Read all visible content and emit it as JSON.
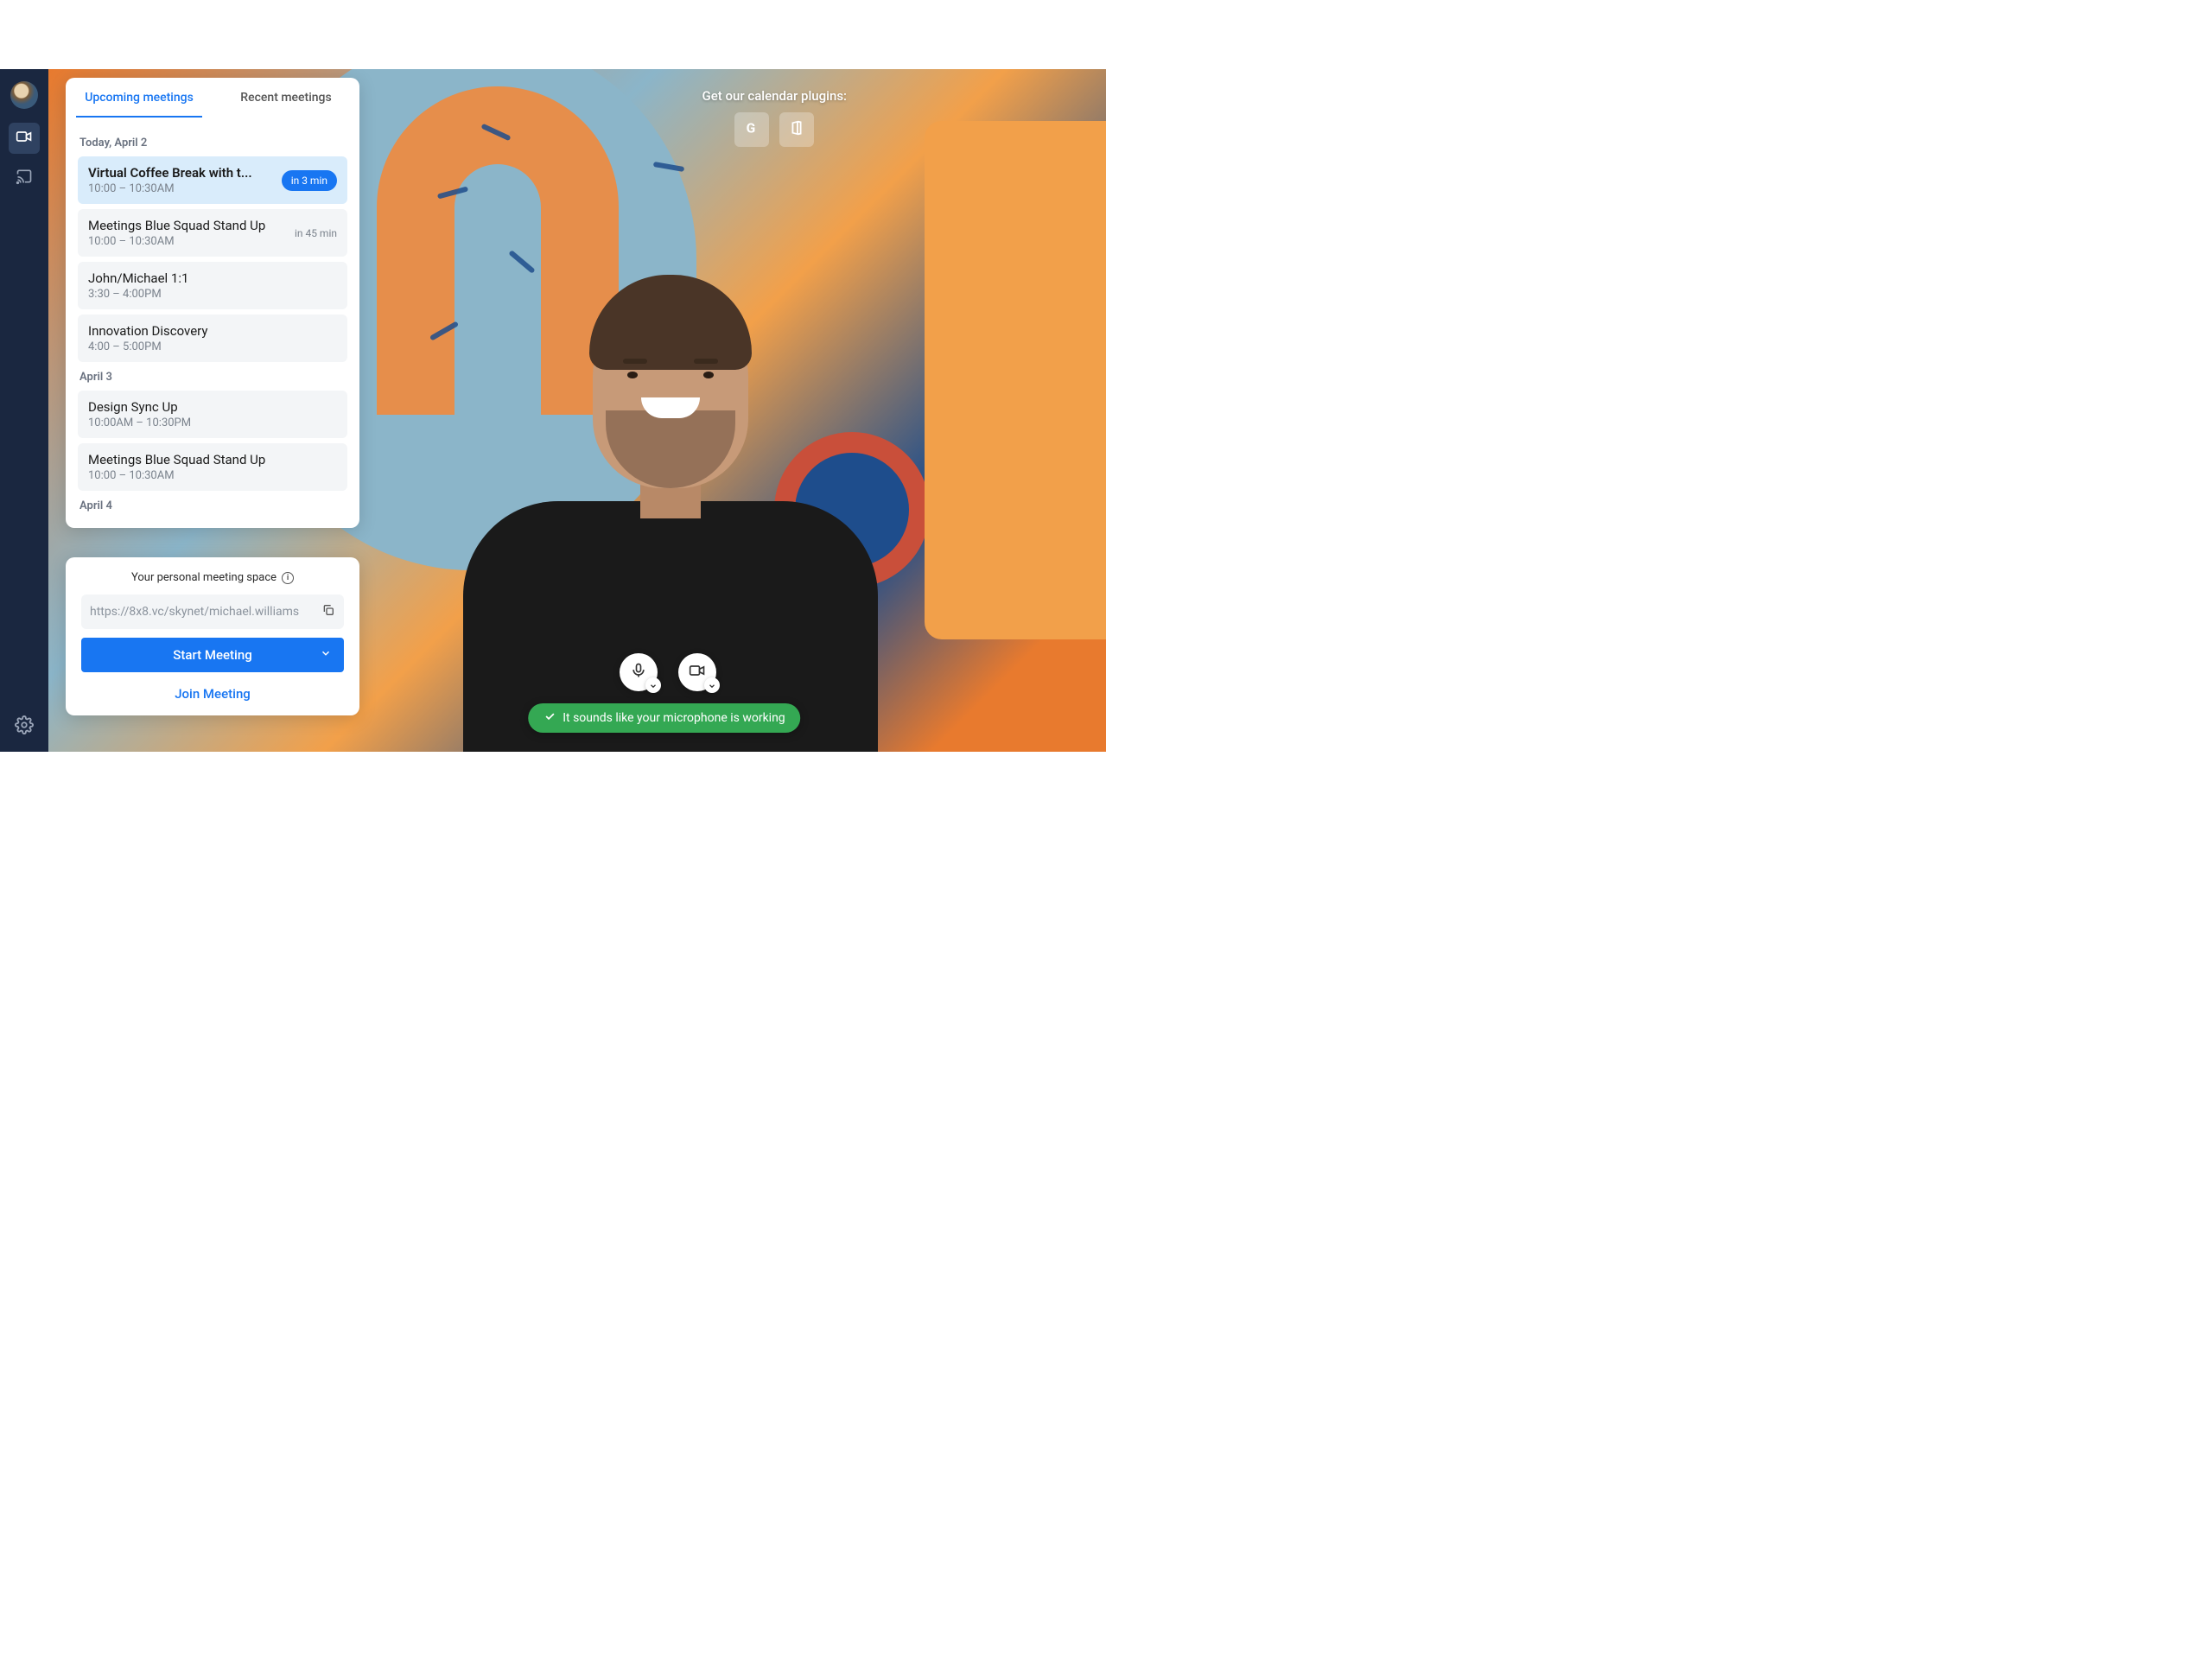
{
  "sidebar": {
    "icons": {
      "avatar": "user-avatar",
      "video": "video-icon",
      "cast": "cast-icon",
      "settings": "gear-icon"
    }
  },
  "tabs": {
    "upcoming": "Upcoming meetings",
    "recent": "Recent meetings"
  },
  "dates": {
    "today": "Today, April 2",
    "april3": "April 3",
    "april4": "April 4"
  },
  "meetings": {
    "today": [
      {
        "title": "Virtual Coffee Break with t...",
        "time": "10:00 – 10:30AM",
        "badge": "in 3 min"
      },
      {
        "title": "Meetings Blue Squad Stand Up",
        "time": "10:00 – 10:30AM",
        "in": "in 45 min"
      },
      {
        "title": "John/Michael 1:1",
        "time": "3:30 – 4:00PM"
      },
      {
        "title": "Innovation Discovery",
        "time": "4:00 – 5:00PM"
      }
    ],
    "april3": [
      {
        "title": "Design Sync Up",
        "time": "10:00AM – 10:30PM"
      },
      {
        "title": "Meetings Blue Squad Stand Up",
        "time": "10:00 – 10:30AM"
      }
    ]
  },
  "personal": {
    "title": "Your personal meeting space",
    "url": "https://8x8.vc/skynet/michael.williams",
    "start": "Start Meeting",
    "join": "Join Meeting"
  },
  "plugins": {
    "title": "Get our calendar plugins:",
    "google": "G",
    "office": "O"
  },
  "controls": {
    "mic": "microphone-icon",
    "camera": "camera-icon"
  },
  "toast": {
    "text": "It sounds like your microphone is working"
  },
  "colors": {
    "accent": "#1876f2",
    "success": "#34a853",
    "sidebar": "#1a2740"
  }
}
